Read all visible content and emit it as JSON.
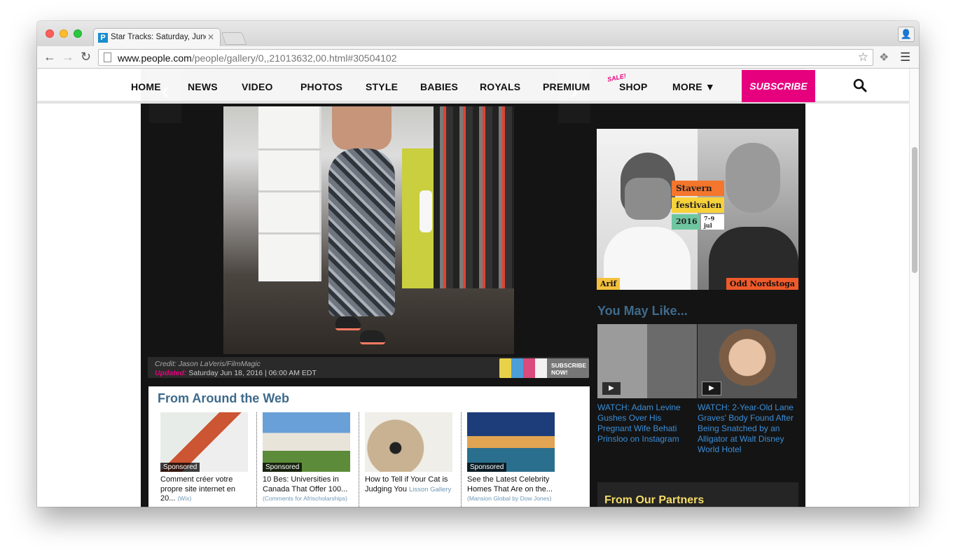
{
  "browser": {
    "tab_title": "Star Tracks: Saturday, June",
    "tab_favicon": "P",
    "url_host": "www.people.com",
    "url_path": "/people/gallery/0,,21013632,00.html#30504102"
  },
  "nav": {
    "items": [
      "HOME",
      "NEWS",
      "VIDEO",
      "PHOTOS",
      "STYLE",
      "BABIES",
      "ROYALS",
      "PREMIUM",
      "SHOP",
      "MORE ▼"
    ],
    "sale_tag": "SALE!",
    "subscribe_label": "SUBSCRIBE"
  },
  "gallery": {
    "credit": "Credit: Jason LaVeris/FilmMagic",
    "updated_label": "Updated:",
    "updated_value": "Saturday Jun 18, 2016 | 06:00 AM EDT",
    "subscribe_promo": "SUBSCRIBE NOW!"
  },
  "from_around_web": {
    "title": "From Around the Web",
    "items": [
      {
        "tag": "Sponsored",
        "text": "Comment créer votre propre site internet en 20...",
        "source": "(Wix)"
      },
      {
        "tag": "Sponsored",
        "text": "10 Bes: Universities in Canada That Offer 100...",
        "source": "(Comments for Afrischolarships)"
      },
      {
        "tag": "",
        "text": "How to Tell if Your Cat is Judging You",
        "source": "Lisson Gallery"
      },
      {
        "tag": "Sponsored",
        "text": "See the Latest Celebrity Homes That Are on the...",
        "source": "(Mansion Global by Dow Jones)"
      }
    ]
  },
  "ad": {
    "logo_lines": [
      "Stavern",
      "festivalen",
      "2016"
    ],
    "logo_dates": "7–9 jul",
    "name_left": "Arif",
    "name_right": "Odd Nordstoga"
  },
  "you_may_like": {
    "title": "You May Like...",
    "items": [
      {
        "prefix": "WATCH:",
        "text": "Adam Levine Gushes Over His Pregnant Wife Behati Prinsloo on Instagram"
      },
      {
        "prefix": "WATCH:",
        "text": "2-Year-Old Lane Graves' Body Found After Being Snatched by an Alligator at Walt Disney World Hotel"
      }
    ]
  },
  "partners": {
    "title": "From Our Partners"
  },
  "colors": {
    "brand_pink": "#e6007e",
    "link_blue": "#3a8ed8",
    "heading_blue": "#3d6a8a"
  }
}
